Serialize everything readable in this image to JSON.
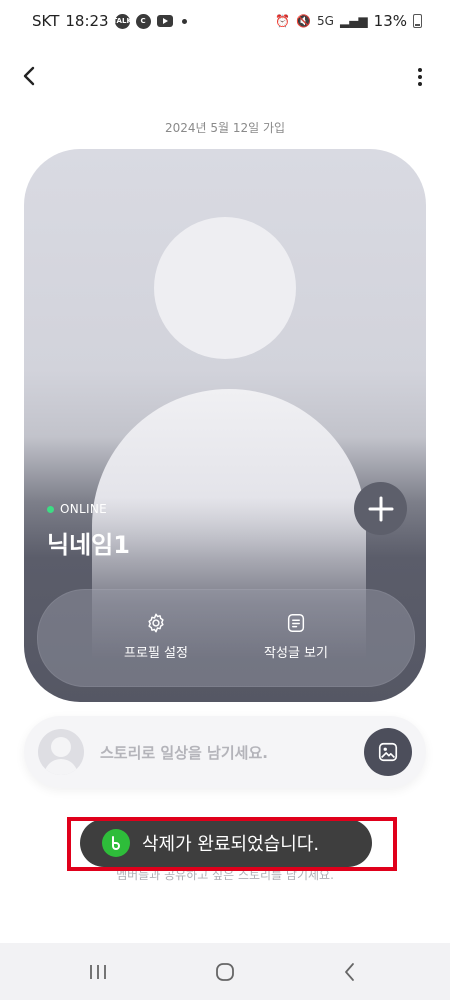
{
  "status_bar": {
    "carrier": "SKT",
    "time": "18:23",
    "talk_icon_text": "TALK",
    "c_icon_text": "C",
    "network": "5G",
    "battery": "13%"
  },
  "header": {
    "back_icon": "chevron-left-icon",
    "more_icon": "more-vertical-icon"
  },
  "join_date": "2024년 5월 12일 가입",
  "profile": {
    "status": "ONLINE",
    "status_color": "#3ddc84",
    "nickname": "닉네임1",
    "actions": [
      {
        "label": "프로필 설정",
        "icon": "gear-icon"
      },
      {
        "label": "작성글 보기",
        "icon": "document-icon"
      }
    ]
  },
  "story": {
    "placeholder": "스토리로 일상을 남기세요."
  },
  "empty_state": {
    "title": "",
    "subtitle": "멤버들과 공유하고 싶은 스토리를 남기세요."
  },
  "toast": {
    "message": "삭제가 완료되었습니다.",
    "highlight_color": "#e0001b"
  },
  "nav": [
    "recent-apps",
    "home",
    "back"
  ]
}
